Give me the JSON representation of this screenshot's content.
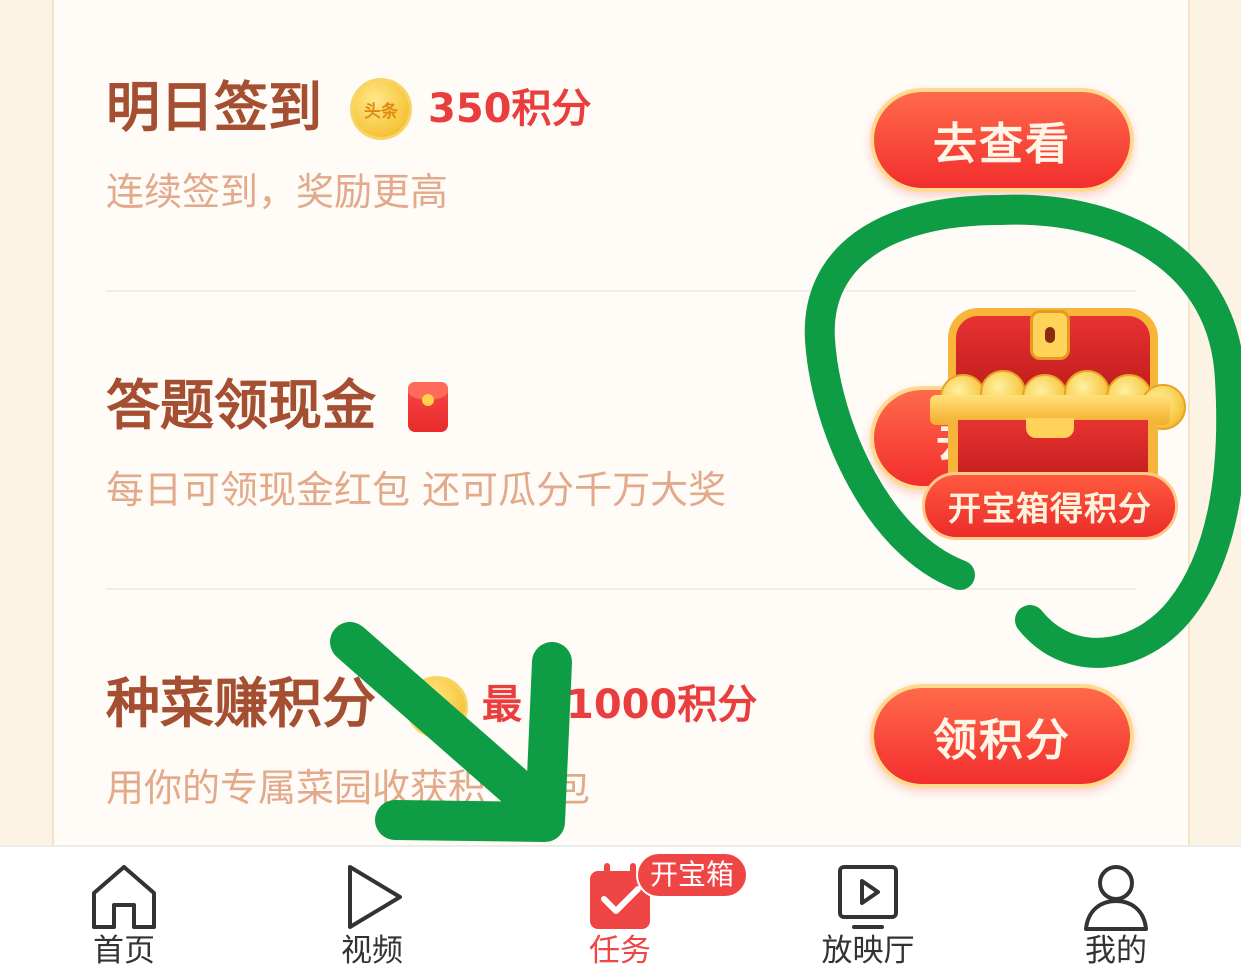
{
  "tasks": [
    {
      "title": "明日签到",
      "coin_label": "头条",
      "reward": "350积分",
      "desc": "连续签到，奖励更高",
      "button": "去查看"
    },
    {
      "title": "答题领现金",
      "desc": "每日可领现金红包 还可瓜分千万大奖",
      "button_partial": "去"
    },
    {
      "title": "种菜赚积分",
      "reward_partial_a": "最",
      "reward_partial_b": "1000积分",
      "desc": "用你的专属菜园收获积",
      "desc_tail": "包",
      "button": "领积分"
    }
  ],
  "chest": {
    "label": "开宝箱得积分"
  },
  "tabbar": {
    "items": [
      {
        "label": "首页",
        "icon": "home-icon"
      },
      {
        "label": "视频",
        "icon": "play-icon"
      },
      {
        "label": "任务",
        "icon": "calendar-check-icon",
        "active": true
      },
      {
        "label": "放映厅",
        "icon": "tv-icon"
      },
      {
        "label": "我的",
        "icon": "user-icon"
      }
    ],
    "badge": "开宝箱"
  },
  "colors": {
    "accent": "#f04545",
    "title": "#a54f32",
    "desc": "#e3a98b",
    "annotation": "#0e9c45"
  }
}
